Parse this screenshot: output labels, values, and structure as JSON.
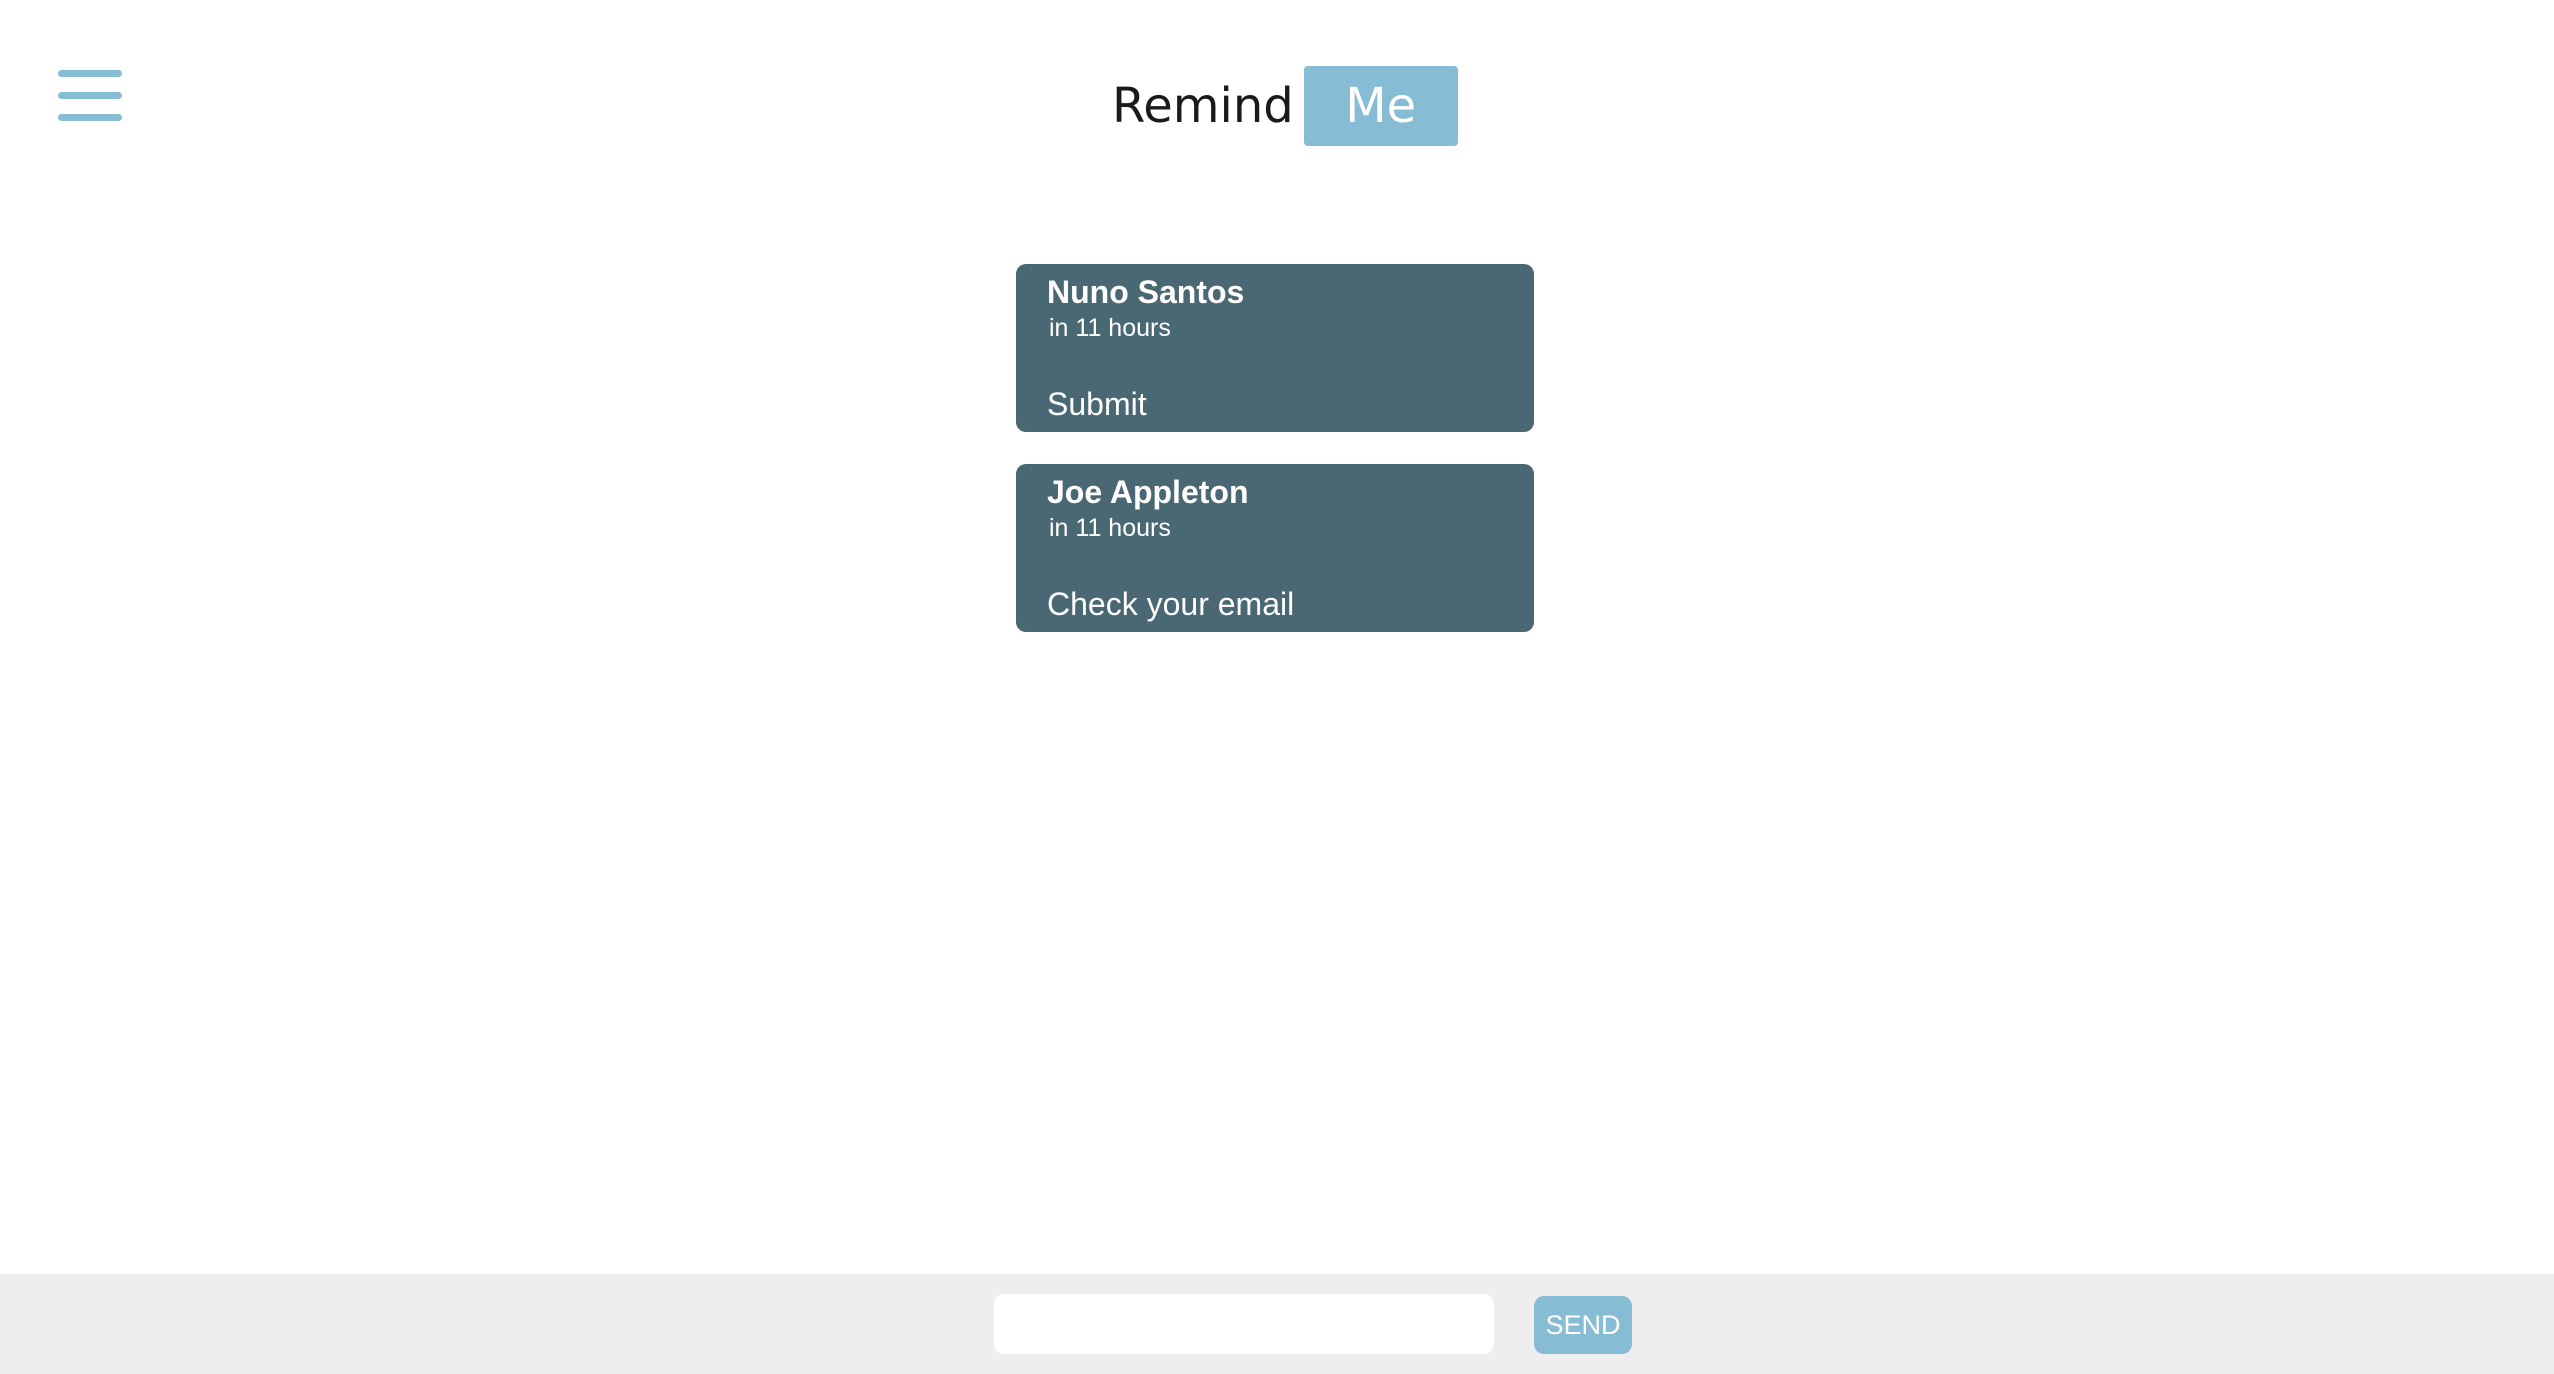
{
  "header": {
    "menu_icon": "hamburger-menu-icon",
    "logo": {
      "word_1": "Remind",
      "word_2": "Me"
    }
  },
  "reminders": [
    {
      "name": "Nuno Santos",
      "time": "in 11 hours",
      "message": "Submit"
    },
    {
      "name": "Joe Appleton",
      "time": "in 11 hours",
      "message": "Check your email"
    }
  ],
  "footer": {
    "input_value": "",
    "input_placeholder": "",
    "send_label": "SEND"
  },
  "colors": {
    "accent": "#86bcd4",
    "card_background": "#4a6874",
    "footer_background": "#eeeeee"
  }
}
